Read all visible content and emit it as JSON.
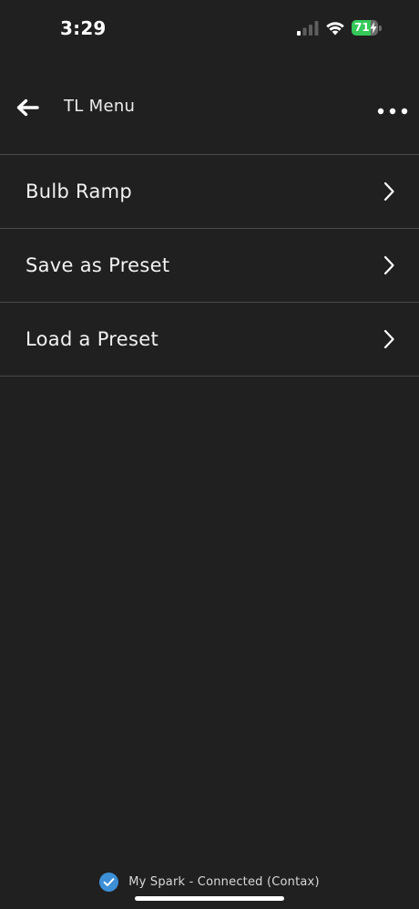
{
  "status_bar": {
    "time": "3:29",
    "battery_level": "71",
    "battery_fraction": 0.71,
    "battery_color": "#34c759",
    "signal_icon": "cellular-signal-icon",
    "wifi_icon": "wifi-icon",
    "charging_icon": "bolt-icon"
  },
  "header": {
    "title": "TL Menu",
    "back_icon": "arrow-left-icon",
    "more_icon": "ellipsis-icon"
  },
  "menu": {
    "items": [
      {
        "label": "Bulb Ramp",
        "icon": "chevron-right-icon"
      },
      {
        "label": "Save as Preset",
        "icon": "chevron-right-icon"
      },
      {
        "label": "Load a Preset",
        "icon": "chevron-right-icon"
      }
    ]
  },
  "connection": {
    "text": "My Spark - Connected (Contax)",
    "icon": "check-circle-icon",
    "icon_color": "#3d8fd6"
  },
  "colors": {
    "background": "#202020",
    "divider": "#4a4a4a"
  }
}
